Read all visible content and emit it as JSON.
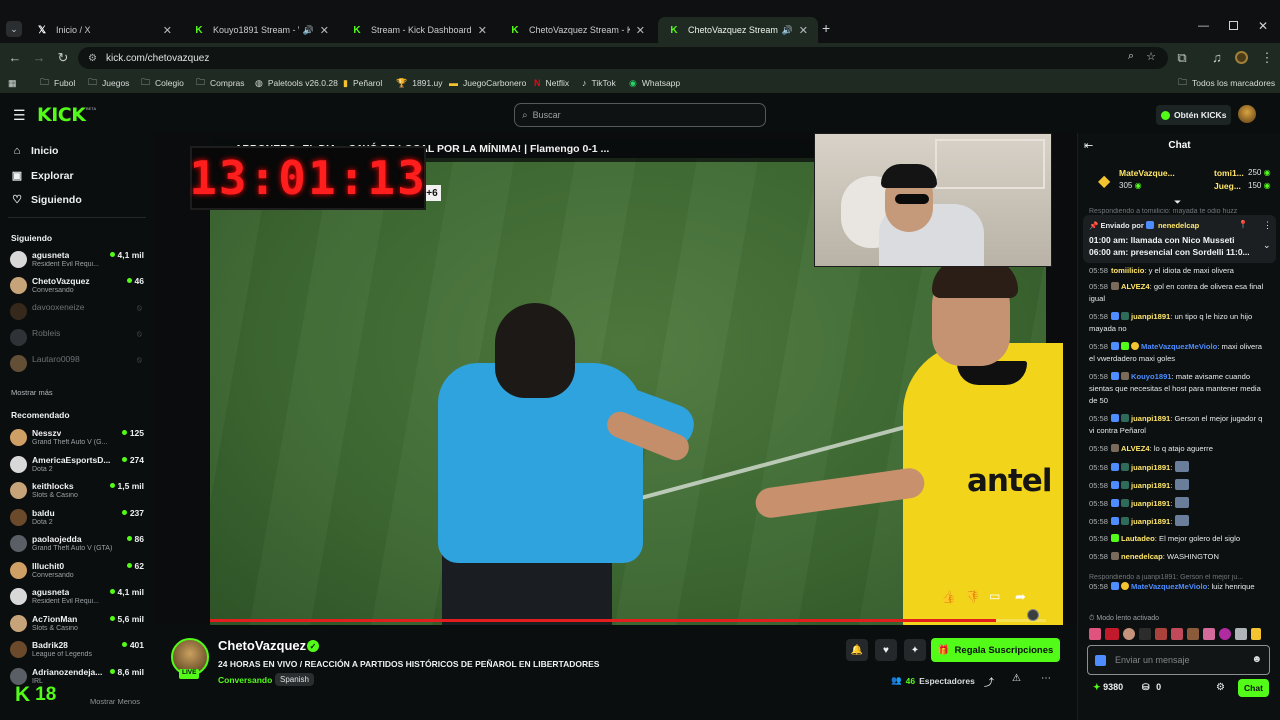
{
  "browser": {
    "tabs": [
      {
        "title": "Inicio / X",
        "icon": "x-logo-icon"
      },
      {
        "title": "Kouyo1891 Stream - Watch",
        "icon": "kick-logo-icon"
      },
      {
        "title": "Stream - Kick Dashboard",
        "icon": "kick-logo-icon"
      },
      {
        "title": "ChetoVazquez Stream - Kick Da",
        "icon": "kick-logo-icon"
      },
      {
        "title": "ChetoVazquez Stream - Wa",
        "icon": "kick-logo-icon"
      }
    ],
    "url": "kick.com/chetovazquez",
    "bookmarks": [
      "Fubol",
      "Juegos",
      "Colegio",
      "Compras",
      "Paletools v26.0.28",
      "Peñarol",
      "1891.uy",
      "JuegoCarbonero",
      "Netflix",
      "TikTok",
      "Whatsapp"
    ],
    "all_bookmarks": "Todos los marcadores"
  },
  "header": {
    "logo": "KICK",
    "beta": "BETA",
    "search_placeholder": "Buscar",
    "get_kicks": "Obtén KICKs"
  },
  "sidebar": {
    "nav": [
      "Inicio",
      "Explorar",
      "Siguiendo"
    ],
    "following_title": "Siguiendo",
    "following": [
      {
        "name": "agusneta",
        "category": "Resident Evil Requi...",
        "viewers": "4,1 mil",
        "live": true
      },
      {
        "name": "ChetoVazquez",
        "category": "Conversando",
        "viewers": "46",
        "live": true
      },
      {
        "name": "davooxeneize",
        "category": "",
        "viewers": "",
        "live": false
      },
      {
        "name": "Robleis",
        "category": "",
        "viewers": "",
        "live": false
      },
      {
        "name": "Lautaro0098",
        "category": "",
        "viewers": "",
        "live": false
      }
    ],
    "show_more": "Mostrar más",
    "recommended_title": "Recomendado",
    "recommended": [
      {
        "name": "Nesszv",
        "category": "Grand Theft Auto V (G...",
        "viewers": "125"
      },
      {
        "name": "AmericaEsportsD...",
        "category": "Dota 2",
        "viewers": "274"
      },
      {
        "name": "keithlocks",
        "category": "Slots & Casino",
        "viewers": "1,5 mil"
      },
      {
        "name": "baldu",
        "category": "Dota 2",
        "viewers": "237"
      },
      {
        "name": "paolaojedda",
        "category": "Grand Theft Auto V (GTA)",
        "viewers": "86"
      },
      {
        "name": "Illuchit0",
        "category": "Conversando",
        "viewers": "62"
      },
      {
        "name": "agusneta",
        "category": "Resident Evil Requi...",
        "viewers": "4,1 mil"
      },
      {
        "name": "Ac7ionMan",
        "category": "Slots & Casino",
        "viewers": "5,6 mil"
      },
      {
        "name": "Badrik28",
        "category": "League of Legends",
        "viewers": "401"
      },
      {
        "name": "Adrianozendeja...",
        "category": "IRL",
        "viewers": "8,6 mil"
      }
    ],
    "show_less": "Mostrar Menos",
    "bottom_badge": "18"
  },
  "video": {
    "clock": "13:01:13",
    "headline": "...ARBONERO: EL DIA... CAYÓ DE LOCAL POR LA MÍNIMA! | Flamengo 0-1 ...",
    "minute_badge": "+6",
    "sponsor": "antel",
    "progress": 0.94
  },
  "stream": {
    "channel": "ChetoVazquez",
    "title": "24 HORAS EN VIVO / REACCIÓN A PARTIDOS HISTÓRICOS DE PEÑAROL EN LIBERTADORES",
    "category": "Conversando",
    "language": "Spanish",
    "live_label": "LIVE",
    "gift_subs": "Regala Suscripciones",
    "viewers": "46",
    "viewers_label": "Espectadores"
  },
  "chat": {
    "title": "Chat",
    "top_gifters": [
      {
        "name": "MateVazque...",
        "amount": "305"
      },
      {
        "name": "tomi1...",
        "amount": "250"
      },
      {
        "name": "Jueg...",
        "amount": "150"
      }
    ],
    "reply_preview": "Respondiendo a tomiilicio: mayada te odio huzz",
    "pinned_by_label": "Enviado por",
    "pinned_user": "nenedelcap",
    "pinned_lines": [
      "01:00 am: llamada con Nico Musseti",
      "06:00 am: presencial con Sordelli 11:0..."
    ],
    "messages": [
      {
        "time": "05:58",
        "user": "tomiilicio",
        "text": "y el idiota de maxi olivera",
        "color": "#ffe66b"
      },
      {
        "time": "05:58",
        "user": "ALVEZ4",
        "text": "gol en contra de olivera esa final igual",
        "color": "#ffe66b"
      },
      {
        "time": "05:58",
        "user": "juanpi1891",
        "text": "un tipo q le hizo un hijo mayada no",
        "color": "#ffe66b"
      },
      {
        "time": "05:58",
        "user": "MateVazquezMeViolo",
        "text": "maxi olivera el vwerdadero maxi goles",
        "color": "#4d8dff"
      },
      {
        "time": "05:58",
        "user": "Kouyo1891",
        "text": "mate avisame cuando sientas que necesitas el host para mantener media de 50",
        "color": "#4d8dff"
      },
      {
        "time": "05:58",
        "user": "juanpi1891",
        "text": "Gerson el mejor jugador q vi contra Peñarol",
        "color": "#ffe66b"
      },
      {
        "time": "05:58",
        "user": "ALVEZ4",
        "text": "lo q atajo aguerre",
        "color": "#ffe66b"
      },
      {
        "time": "05:58",
        "user": "juanpi1891",
        "text": "",
        "color": "#ffe66b"
      },
      {
        "time": "05:58",
        "user": "juanpi1891",
        "text": "",
        "color": "#ffe66b"
      },
      {
        "time": "05:58",
        "user": "juanpi1891",
        "text": "",
        "color": "#ffe66b"
      },
      {
        "time": "05:58",
        "user": "juanpi1891",
        "text": "",
        "color": "#ffe66b"
      },
      {
        "time": "05:58",
        "user": "Lautadeo",
        "text": "El mejor golero del siglo",
        "color": "#ffe66b"
      },
      {
        "time": "05:58",
        "user": "nenedelcap",
        "text": "WASHINGTON",
        "color": "#ffe66b"
      }
    ],
    "reply2": "Respondiendo a juanpi1891: Gerson el mejor ju...",
    "last_message": {
      "time": "05:58",
      "user": "MateVazquezMeViolo",
      "text": "luiz henrique",
      "color": "#4d8dff"
    },
    "slow_mode": "Modo lento activado",
    "input_placeholder": "Enviar un mensaje",
    "points": "9380",
    "gifts": "0",
    "send_label": "Chat"
  },
  "colors": {
    "kick_green": "#53fc18",
    "chat_bg": "#0d1011",
    "page_bg": "#0b0e0f"
  }
}
